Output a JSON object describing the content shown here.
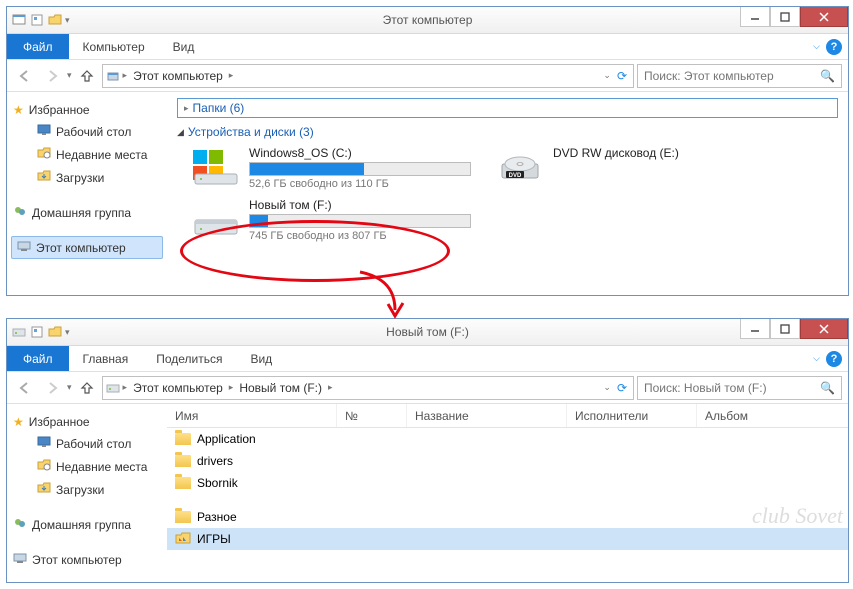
{
  "win1": {
    "title": "Этот компьютер",
    "ribbon": {
      "file": "Файл",
      "tabs": [
        "Компьютер",
        "Вид"
      ]
    },
    "breadcrumb": [
      "Этот компьютер"
    ],
    "search_placeholder": "Поиск: Этот компьютер",
    "sidebar": {
      "favorites_label": "Избранное",
      "favorites": [
        {
          "label": "Рабочий стол",
          "icon": "desktop"
        },
        {
          "label": "Недавние места",
          "icon": "recent"
        },
        {
          "label": "Загрузки",
          "icon": "downloads"
        }
      ],
      "homegroup": "Домашняя группа",
      "this_pc": "Этот компьютер"
    },
    "sections": {
      "folders_label": "Папки (6)",
      "devices_label": "Устройства и диски (3)"
    },
    "drives": [
      {
        "name": "Windows8_OS (C:)",
        "free": "52,6 ГБ свободно из 110 ГБ",
        "fill_pct": 52,
        "type": "hdd"
      },
      {
        "name": "DVD RW дисковод (E:)",
        "type": "dvd"
      },
      {
        "name": "Новый том (F:)",
        "free": "745 ГБ свободно из 807 ГБ",
        "fill_pct": 8,
        "type": "hdd"
      }
    ]
  },
  "win2": {
    "title": "Новый том (F:)",
    "ribbon": {
      "file": "Файл",
      "tabs": [
        "Главная",
        "Поделиться",
        "Вид"
      ]
    },
    "breadcrumb": [
      "Этот компьютер",
      "Новый том (F:)"
    ],
    "search_placeholder": "Поиск: Новый том (F:)",
    "columns": [
      "Имя",
      "№",
      "Название",
      "Исполнители",
      "Альбом"
    ],
    "files": [
      {
        "name": "Application",
        "icon": "folder"
      },
      {
        "name": "drivers",
        "icon": "folder"
      },
      {
        "name": "Sbornik",
        "icon": "folder"
      },
      {
        "name": "Разное",
        "icon": "folder"
      },
      {
        "name": "ИГРЫ",
        "icon": "game",
        "selected": true
      }
    ],
    "sidebar": {
      "favorites_label": "Избранное",
      "favorites": [
        {
          "label": "Рабочий стол"
        },
        {
          "label": "Недавние места"
        },
        {
          "label": "Загрузки"
        }
      ],
      "homegroup": "Домашняя группа",
      "this_pc": "Этот компьютер"
    }
  },
  "watermark": "club Sovet"
}
